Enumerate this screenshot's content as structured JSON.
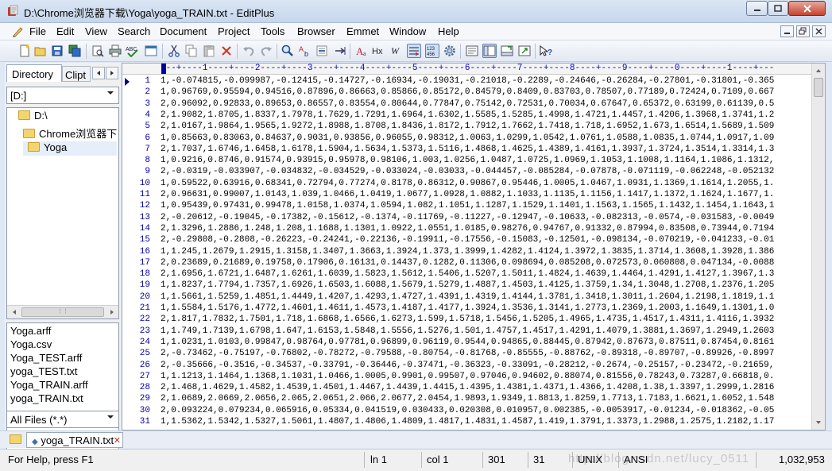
{
  "window": {
    "title": "D:\\Chrome浏览器下载\\Yoga\\yoga_TRAIN.txt - EditPlus",
    "controls": {
      "minimize": "▁",
      "maximize": "□",
      "close": "✕"
    }
  },
  "menu": {
    "items": [
      "File",
      "Edit",
      "View",
      "Search",
      "Document",
      "Project",
      "Tools",
      "Browser",
      "Emmet",
      "Window",
      "Help"
    ],
    "mdi": {
      "minimize": "‒",
      "restore": "❐",
      "close": "✕"
    }
  },
  "toolbar": {
    "icons": [
      "new-file-icon",
      "open-folder-icon",
      "save-icon",
      "save-all-icon",
      "print-preview-icon",
      "print-icon",
      "spell-check-icon",
      "browser-preview-icon",
      "cut-icon",
      "copy-icon",
      "paste-icon",
      "delete-icon",
      "undo-icon",
      "redo-icon",
      "find-icon",
      "replace-icon",
      "goto-line-icon",
      "font-icon",
      "hex-icon",
      "word-wrap-icon",
      "ruler-icon",
      "line-number-icon",
      "settings-icon",
      "cliptext-icon",
      "directory-icon",
      "output-icon",
      "fullscreen-icon",
      "context-help-icon"
    ]
  },
  "left_panel": {
    "tabs": {
      "directory": "Directory",
      "cliptext": "Clipt"
    },
    "drive": "[D:]",
    "tree": [
      {
        "label": "D:\\",
        "indent": 0
      },
      {
        "label": "Chrome浏览器下载",
        "indent": 1
      },
      {
        "label": "Yoga",
        "indent": 2,
        "selected": true
      }
    ],
    "files": [
      "Yoga.arff",
      "Yoga.csv",
      "Yoga_TEST.arff",
      "yoga_TEST.txt",
      "Yoga_TRAIN.arff",
      "yoga_TRAIN.txt"
    ],
    "filter": "All Files (*.*)"
  },
  "editor": {
    "ruler": "---+----1----+----2----+----3----+----4----+----5----+----6----+----7----+----8----+----9----+----0----+----1----+---",
    "lines": [
      "1,-0.074815,-0.099987,-0.12415,-0.14727,-0.16934,-0.19031,-0.21018,-0.2289,-0.24646,-0.26284,-0.27801,-0.31801,-0.365",
      "1,0.96769,0.95594,0.94516,0.87896,0.86663,0.85866,0.85172,0.84579,0.8409,0.83703,0.78507,0.77189,0.72424,0.7109,0.667",
      "2,0.96092,0.92833,0.89653,0.86557,0.83554,0.80644,0.77847,0.75142,0.72531,0.70034,0.67647,0.65372,0.63199,0.61139,0.5",
      "2,1.9082,1.8705,1.8337,1.7978,1.7629,1.7291,1.6964,1.6302,1.5585,1.5285,1.4998,1.4721,1.4457,1.4206,1.3968,1.3741,1.2",
      "2,1.0167,1.9864,1.9565,1.9272,1.8988,1.8708,1.8436,1.8172,1.7912,1.7662,1.7418,1.718,1.6952,1.673,1.6514,1.5689,1.509",
      "1,0.85663,0.83063,0.84637,0.9031,0.93856,0.96055,0.98312,1.0063,1.0299,1.0542,1.0761,1.0588,1.0835,1.0744,1.0917,1.09",
      "2,1.7037,1.6746,1.6458,1.6178,1.5904,1.5634,1.5373,1.5116,1.4868,1.4625,1.4389,1.4161,1.3937,1.3724,1.3514,1.3314,1.3",
      "1,0.9216,0.8746,0.91574,0.93915,0.95978,0.98106,1.003,1.0256,1.0487,1.0725,1.0969,1.1053,1.1008,1.1164,1.1086,1.1312,",
      "2,-0.0319,-0.033907,-0.034832,-0.034529,-0.033024,-0.03033,-0.044457,-0.085284,-0.07878,-0.071119,-0.062248,-0.052132",
      "1,0.59522,0.63916,0.68341,0.72794,0.77274,0.8178,0.86312,0.90867,0.95446,1.0005,1.0467,1.0931,1.1369,1.1614,1.2055,1.",
      "2,0.96631,0.99007,1.0143,1.039,1.0466,1.0419,1.0677,1.0928,1.0882,1.1033,1.1135,1.1156,1.1417,1.1372,1.1624,1.1677,1.",
      "1,0.95439,0.97431,0.99478,1.0158,1.0374,1.0594,1.082,1.1051,1.1287,1.1529,1.1401,1.1563,1.1565,1.1432,1.1454,1.1643,1",
      "2,-0.20612,-0.19045,-0.17382,-0.15612,-0.1374,-0.11769,-0.11227,-0.12947,-0.10633,-0.082313,-0.0574,-0.031583,-0.0049",
      "2,1.3296,1.2886,1.248,1.208,1.1688,1.1301,1.0922,1.0551,1.0185,0.98276,0.94767,0.91332,0.87994,0.83508,0.73944,0.7194",
      "2,-0.29808,-0.2808,-0.26223,-0.24241,-0.22136,-0.19911,-0.17556,-0.15083,-0.12501,-0.098134,-0.070219,-0.041233,-0.01",
      "1,1.245,1.2679,1.2915,1.3158,1.3407,1.3663,1.3924,1.373,1.3999,1.4282,1.4124,1.3972,1.3835,1.3714,1.3608,1.3928,1.386",
      "2,0.23689,0.21689,0.19758,0.17906,0.16131,0.14437,0.1282,0.11306,0.098694,0.085208,0.072573,0.060808,0.047134,-0.0088",
      "2,1.6956,1.6721,1.6487,1.6261,1.6039,1.5823,1.5612,1.5406,1.5207,1.5011,1.4824,1.4639,1.4464,1.4291,1.4127,1.3967,1.3",
      "1,1.8237,1.7794,1.7357,1.6926,1.6503,1.6088,1.5679,1.5279,1.4887,1.4503,1.4125,1.3759,1.34,1.3048,1.2708,1.2376,1.205",
      "1,1.5661,1.5259,1.4851,1.4449,1.4207,1.4293,1.4727,1.4391,1.4319,1.4144,1.3781,1.3418,1.3011,1.2604,1.2198,1.1819,1.1",
      "1,1.5584,1.5176,1.4772,1.4601,1.4611,1.4573,1.4187,1.4177,1.3924,1.3536,1.3141,1.2773,1.2369,1.2003,1.1649,1.1301,1.0",
      "2,1.817,1.7832,1.7501,1.718,1.6868,1.6566,1.6273,1.599,1.5718,1.5456,1.5205,1.4965,1.4735,1.4517,1.4311,1.4116,1.3932",
      "1,1.749,1.7139,1.6798,1.647,1.6153,1.5848,1.5556,1.5276,1.501,1.4757,1.4517,1.4291,1.4079,1.3881,1.3697,1.2949,1.2603",
      "1,1.0231,1.0103,0.99847,0.98764,0.97781,0.96899,0.96119,0.9544,0.94865,0.88445,0.87942,0.87673,0.87511,0.87454,0.8161",
      "2,-0.73462,-0.75197,-0.76802,-0.78272,-0.79588,-0.80754,-0.81768,-0.85555,-0.88762,-0.89318,-0.89707,-0.89926,-0.8997",
      "2,-0.35666,-0.3516,-0.34537,-0.33791,-0.36446,-0.37471,-0.36323,-0.33091,-0.28212,-0.2674,-0.25157,-0.23472,-0.21659,",
      "1,1.1213,1.1464,1.1368,1.1031,1.0466,1.0005,0.9901,0.99507,0.97046,0.94602,0.88074,0.81556,0.78243,0.73287,0.66818,0.",
      "2,1.468,1.4629,1.4582,1.4539,1.4501,1.4467,1.4439,1.4415,1.4395,1.4381,1.4371,1.4366,1.4208,1.38,1.3397,1.2999,1.2816",
      "2,1.0689,2.0669,2.0656,2.065,2.0651,2.066,2.0677,2.0454,1.9893,1.9349,1.8813,1.8259,1.7713,1.7183,1.6621,1.6052,1.548",
      "2,0.093224,0.079234,0.065916,0.05334,0.041519,0.030433,0.020308,0.010957,0.002385,-0.0053917,-0.01234,-0.018362,-0.05",
      "1,1.5362,1.5342,1.5327,1.5061,1.4807,1.4806,1.4809,1.4817,1.4831,1.4587,1.419,1.3791,1.3373,1.2988,1.2575,1.2182,1.17"
    ]
  },
  "doc_tab": {
    "label": "yoga_TRAIN.txt",
    "close": "✕"
  },
  "status": {
    "help": "For Help, press F1",
    "line": "ln 1",
    "col": "col 1",
    "count1": "301",
    "count2": "31",
    "eol": "UNIX",
    "encoding": "ANSI",
    "size": "1,032,953",
    "watermark": "http://blog.csdn.net/lucy_0511"
  }
}
